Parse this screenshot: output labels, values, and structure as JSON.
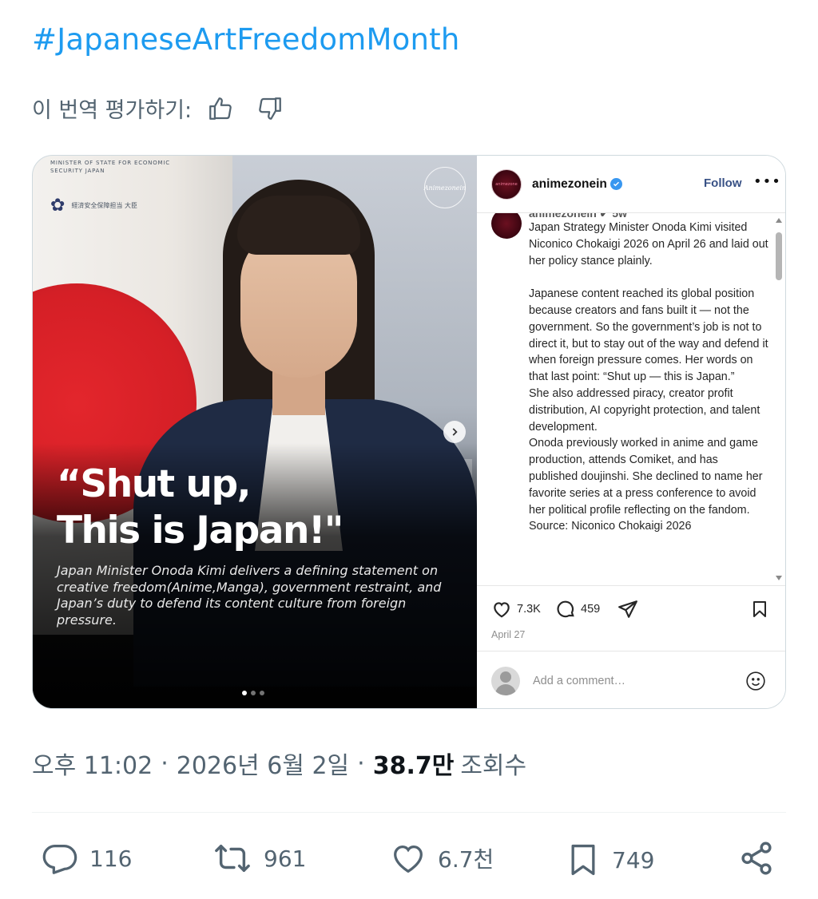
{
  "tweet": {
    "hashtag": "#JapaneseArtFreedomMonth",
    "rate_translation_label": "이 번역 평가하기:",
    "icons": {
      "thumbs_up": "thumbs-up-icon",
      "thumbs_down": "thumbs-down-icon"
    }
  },
  "card_image": {
    "ministry_text": "MINISTER OF STATE FOR ECONOMIC SECURITY JAPAN",
    "ministry_jp": "経済安全保障担当 大臣",
    "watermark": "Animezonein",
    "quote_line1": "“Shut up,",
    "quote_line2": "This is Japan!\"",
    "caption": "Japan Minister Onoda Kimi delivers a defining statement on creative freedom(Anime,Manga), government restraint, and Japan’s duty to defend its content culture from foreign pressure.",
    "slide_count": 3,
    "active_slide": 1
  },
  "instagram": {
    "username": "animezonein",
    "follow_label": "Follow",
    "more_label": "•••",
    "caption_cut": "animezonein ✔ 5w",
    "paragraphs": [
      "Japan Strategy Minister Onoda Kimi visited Niconico Chokaigi 2026 on April 26 and laid out her policy stance plainly.",
      "Japanese content reached its global position because creators and fans built it — not the government. So the government’s job is not to direct it, but to stay out of the way and defend it when foreign pressure comes. Her words on that last point: “Shut up — this is Japan.”",
      "She also addressed piracy, creator profit distribution, AI copyright protection, and talent development.",
      "Onoda previously worked in anime and game production, attends Comiket, and has published doujinshi. She declined to name her favorite series at a press conference to avoid her political profile reflecting on the fandom.",
      "Source: Niconico Chokaigi 2026"
    ],
    "likes": "7.3K",
    "comments": "459",
    "date": "April 27",
    "comment_placeholder": "Add a comment…"
  },
  "meta": {
    "time": "오후 11:02",
    "date": "2026년 6월 2일",
    "separator": "·",
    "views_count": "38.7만",
    "views_label": "조회수"
  },
  "actions": {
    "replies": "116",
    "reposts": "961",
    "likes": "6.7천",
    "bookmarks": "749"
  },
  "colors": {
    "link": "#1d9bf0",
    "secondary_text": "#536471",
    "primary_text": "#0f1419",
    "ig_follow": "#385185"
  }
}
